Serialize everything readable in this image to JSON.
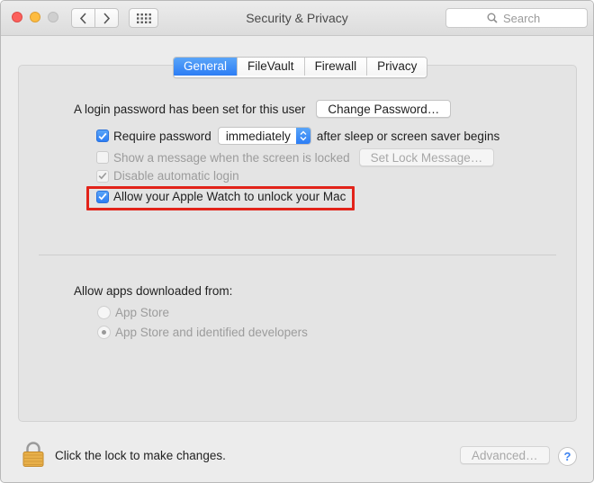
{
  "window": {
    "title": "Security & Privacy",
    "search_placeholder": "Search"
  },
  "icons": {
    "back": "chevron-left-icon",
    "forward": "chevron-right-icon",
    "show_all": "grid-icon",
    "search": "magnifier-icon",
    "lock": "padlock-icon",
    "help": "question-mark-icon"
  },
  "tabs": [
    {
      "label": "General",
      "active": true
    },
    {
      "label": "FileVault",
      "active": false
    },
    {
      "label": "Firewall",
      "active": false
    },
    {
      "label": "Privacy",
      "active": false
    }
  ],
  "general": {
    "login_text": "A login password has been set for this user",
    "change_password_label": "Change Password…",
    "require_password_label": "Require password",
    "require_password_checked": true,
    "require_password_delay": "immediately",
    "require_password_suffix": "after sleep or screen saver begins",
    "show_message_label": "Show a message when the screen is locked",
    "show_message_checked": false,
    "set_lock_message_label": "Set Lock Message…",
    "disable_login_label": "Disable automatic login",
    "disable_login_checked": true,
    "apple_watch_label": "Allow your Apple Watch to unlock your Mac",
    "apple_watch_checked": true
  },
  "downloads": {
    "heading": "Allow apps downloaded from:",
    "options": [
      {
        "label": "App Store",
        "selected": false
      },
      {
        "label": "App Store and identified developers",
        "selected": true
      }
    ]
  },
  "footer": {
    "lock_text": "Click the lock to make changes.",
    "advanced_label": "Advanced…",
    "help_label": "?"
  },
  "colors": {
    "accent": "#2c7df5",
    "highlight_box": "#e2231a",
    "lock_gold": "#e8b04a"
  }
}
